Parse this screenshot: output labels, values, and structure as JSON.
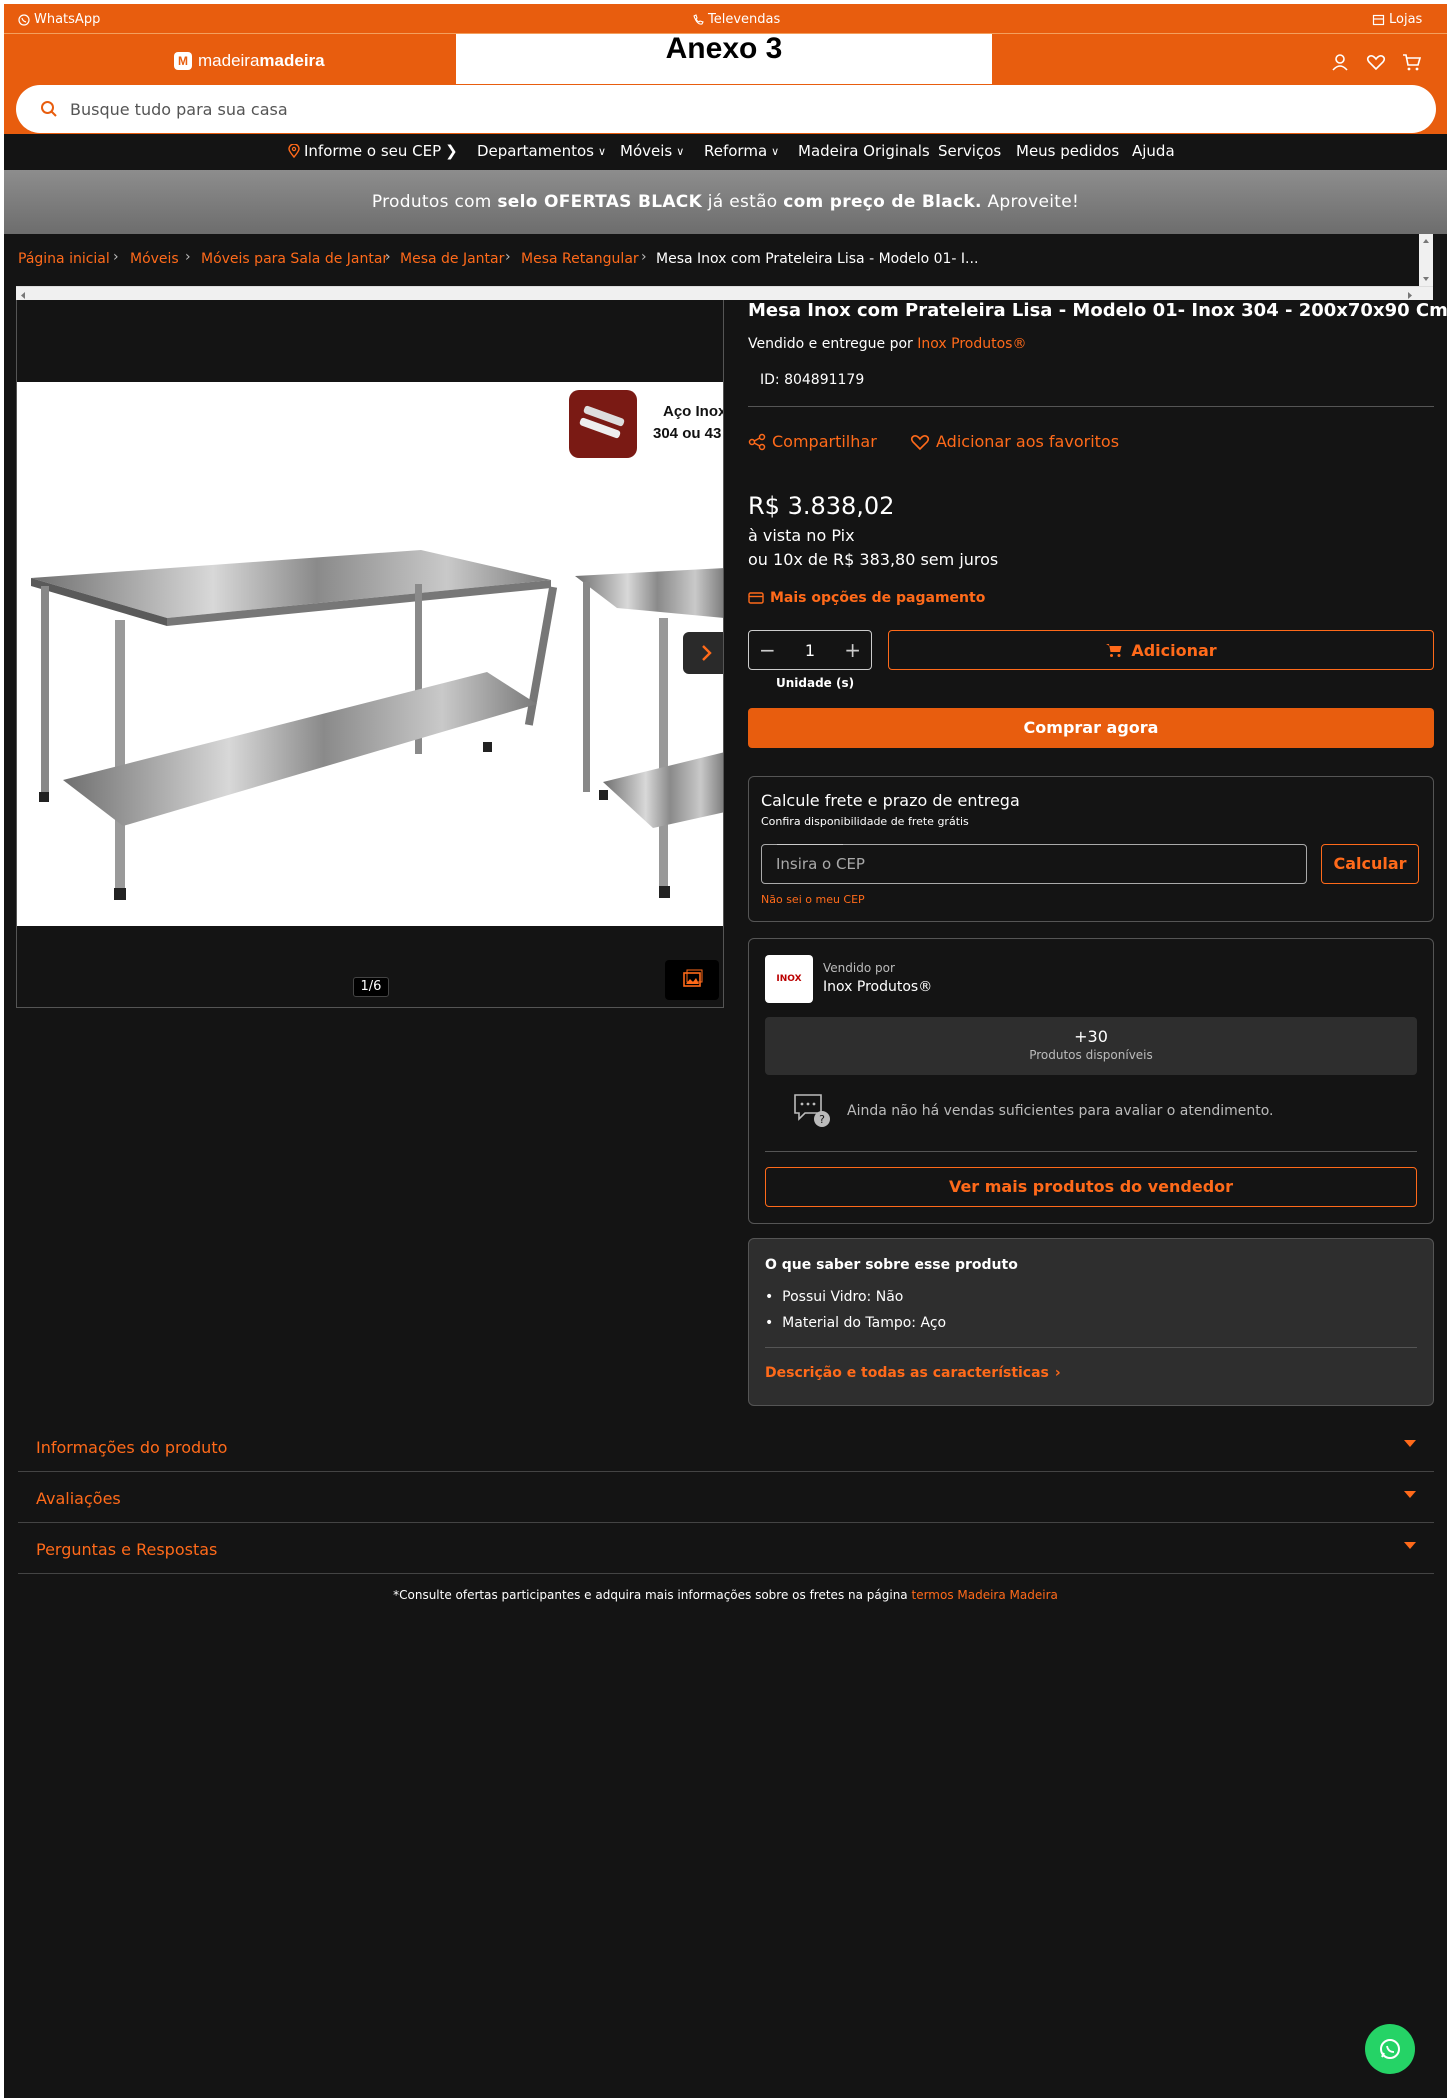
{
  "overlay": {
    "label": "Anexo 3"
  },
  "topbar": {
    "whatsapp": "WhatsApp",
    "televendas": "Televendas",
    "lojas": "Lojas"
  },
  "header": {
    "logo_light": "madeira",
    "logo_bold": "madeira"
  },
  "search": {
    "placeholder": "Busque tudo para sua casa"
  },
  "nav": {
    "cep": "Informe o seu CEP",
    "items": [
      "Departamentos",
      "Móveis",
      "Reforma",
      "Madeira Originals",
      "Serviços",
      "Meus pedidos",
      "Ajuda"
    ]
  },
  "banner": {
    "p1": "Produtos com ",
    "b1": "selo OFERTAS BLACK",
    "p2": " já estão ",
    "b2": "com preço de Black.",
    "p3": " Aproveite!"
  },
  "breadcrumb": {
    "items": [
      "Página inicial",
      "Móveis",
      "Móveis para Sala de Jantar",
      "Mesa de Jantar",
      "Mesa Retangular"
    ],
    "current": "Mesa Inox com Prateleira Lisa - Modelo 01- I..."
  },
  "gallery": {
    "counter": "1/6",
    "badge_line1": "Aço Inox",
    "badge_line2": "304 ou 43"
  },
  "product": {
    "title": "Mesa Inox com Prateleira Lisa - Modelo 01- Inox 304 - 200x70x90 Cm",
    "sold_prefix": "Vendido e entregue por ",
    "seller": "Inox Produtos®",
    "id": "ID: 804891179",
    "share": "Compartilhar",
    "favorite": "Adicionar aos favoritos",
    "price": "R$ 3.838,02",
    "pix": "à vista no Pix",
    "installments": "ou 10x de R$ 383,80 sem juros",
    "more_payment": "Mais opções de pagamento",
    "qty": "1",
    "unit": "Unidade (s)",
    "add": "Adicionar",
    "buy_now": "Comprar agora"
  },
  "freight": {
    "title": "Calcule frete e prazo de entrega",
    "subtitle": "Confira disponibilidade de frete grátis",
    "placeholder": "Insira o CEP",
    "button": "Calcular",
    "no_cep": "Não sei o meu CEP"
  },
  "seller_box": {
    "logo": "INOX",
    "sold_by": "Vendido por",
    "name": "Inox Produtos®",
    "count": "+30",
    "count_label": "Produtos disponíveis",
    "rating_text": "Ainda não há vendas suficientes para avaliar o atendimento.",
    "button": "Ver mais produtos do vendedor"
  },
  "know": {
    "title": "O que saber sobre esse produto",
    "items": [
      {
        "label": "Possui Vidro: ",
        "value": "Não"
      },
      {
        "label": "Material do Tampo: ",
        "value": "Aço"
      }
    ],
    "link": "Descrição e todas as características"
  },
  "accordions": [
    "Informações do produto",
    "Avaliações",
    "Perguntas e Respostas"
  ],
  "footer": {
    "text": "*Consulte ofertas participantes e adquira mais informações sobre os fretes na página ",
    "link": "termos Madeira Madeira"
  },
  "colors": {
    "brand": "#e85d0e",
    "accent_text": "#ff6a1a",
    "background": "#141414",
    "whatsapp": "#25d366"
  }
}
